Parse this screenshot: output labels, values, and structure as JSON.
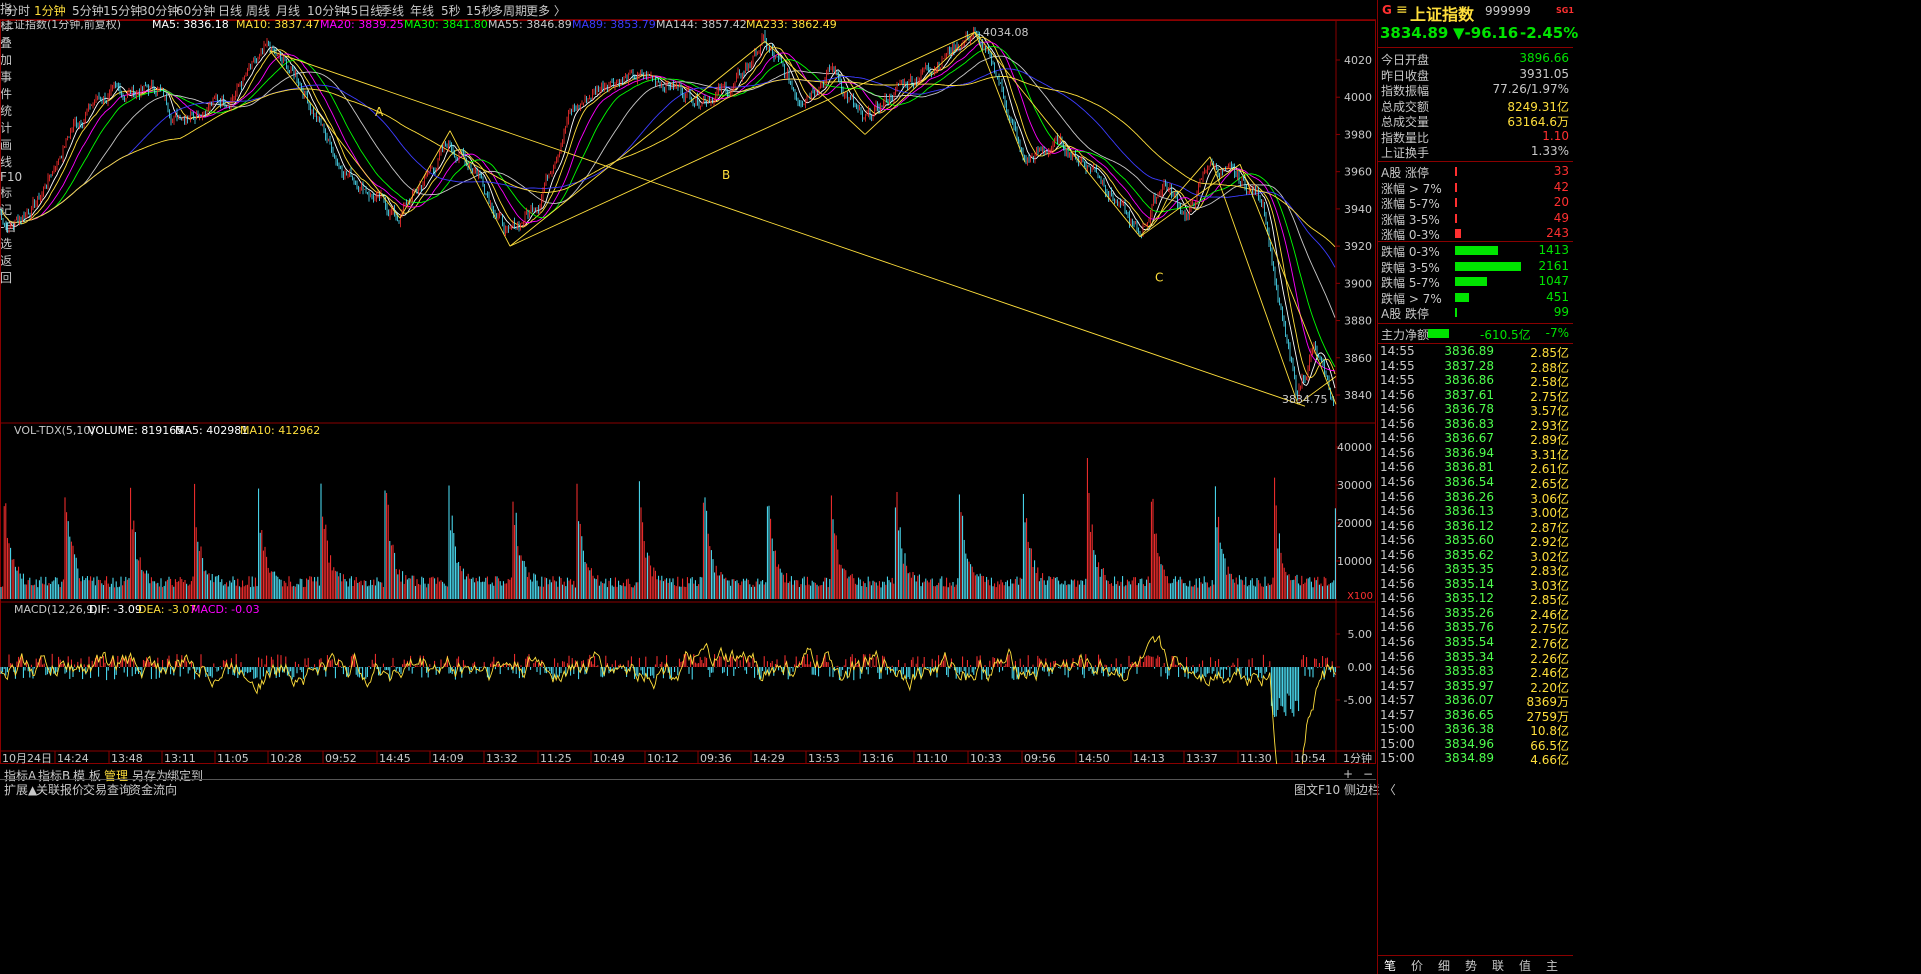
{
  "colors": {
    "up": "#ff3030",
    "down": "#00e400",
    "text": "#c8c8c8",
    "yellow": "#ffdf3c",
    "cyan": "#4fe8ff",
    "grid": "#8a0000",
    "ma5": "#ffffff",
    "ma10": "#ffdf3c",
    "ma20": "#ff00ff",
    "ma30": "#00ff00",
    "ma55": "#c8c8c8",
    "ma89": "#3c3cff"
  },
  "toolbar": {
    "periods": [
      "分时",
      "1分钟",
      "5分钟",
      "15分钟",
      "30分钟",
      "60分钟",
      "日线",
      "周线",
      "月线",
      "10分钟",
      "45日线",
      "季线",
      "年线",
      "5秒",
      "15秒",
      "多周期",
      "更多 〉"
    ],
    "active": "1分钟",
    "tools": [
      "指标",
      "叠加",
      "事件",
      "统计",
      "画线",
      "F10",
      "标记",
      "-自选",
      "返回"
    ]
  },
  "main": {
    "title": "上证指数(1分钟,前复权)",
    "ma": [
      {
        "label": "MA5: 3836.18",
        "color": "#ffffff"
      },
      {
        "label": "MA10: 3837.47",
        "color": "#ffdf3c"
      },
      {
        "label": "MA20: 3839.25",
        "color": "#ff00ff"
      },
      {
        "label": "MA30: 3841.80",
        "color": "#00ff00"
      },
      {
        "label": "MA55: 3846.89",
        "color": "#c8c8c8"
      },
      {
        "label": "MA89: 3853.79",
        "color": "#3c3cff"
      },
      {
        "label": "MA144: 3857.42",
        "color": "#c8c8c8"
      },
      {
        "label": "MA233: 3862.49",
        "color": "#ffdf3c"
      }
    ],
    "y_ticks": [
      "4020",
      "4000",
      "3980",
      "3960",
      "3940",
      "3920",
      "3900",
      "3880",
      "3860",
      "3840"
    ],
    "high_label": "4034.08",
    "low_label": "3834.75",
    "wave_labels": [
      "A",
      "B",
      "C"
    ]
  },
  "volume": {
    "label": "VOL-TDX(5,10)",
    "volume": "VOLUME: 819165",
    "ma5": "MA5: 402981",
    "ma10": "MA10: 412962",
    "y_ticks": [
      "40000",
      "30000",
      "20000",
      "10000"
    ],
    "unit": "X100"
  },
  "macd": {
    "label": "MACD(12,26,9)",
    "dif": "DIF: -3.09",
    "dea": "DEA: -3.07",
    "macd": "MACD: -0.03",
    "y_ticks": [
      "5.00",
      "0.00",
      "-5.00"
    ]
  },
  "time_axis": {
    "labels": [
      "10月24日",
      "14:24",
      "13:48",
      "13:11",
      "11:05",
      "10:28",
      "09:52",
      "14:45",
      "14:09",
      "13:32",
      "11:25",
      "10:49",
      "10:12",
      "09:36",
      "14:29",
      "13:53",
      "13:16",
      "11:10",
      "10:33",
      "09:56",
      "14:50",
      "14:13",
      "13:37",
      "11:30",
      "10:54"
    ],
    "period": "1分钟"
  },
  "bottom_tabs": {
    "row1": [
      "指标A",
      "指标B",
      "模 板",
      "管理",
      "另存为",
      "绑定到"
    ],
    "row2": [
      "扩展▲",
      "关联报价",
      "交易查询",
      "资金流向"
    ],
    "plus_minus": [
      "+",
      "−"
    ],
    "right_label": "图文F10 侧边栏 〈"
  },
  "panel": {
    "flag": "G",
    "menu_icon": "≡",
    "name": "上证指数",
    "code": "999999",
    "sg": "SG1",
    "price": "3834.89",
    "change": "▼-96.16",
    "pct": "-2.45%",
    "stats": [
      {
        "label": "今日开盘",
        "value": "3896.66",
        "color": "#00e400"
      },
      {
        "label": "昨日收盘",
        "value": "3931.05",
        "color": "#c8c8c8"
      },
      {
        "label": "指数振幅",
        "value": "77.26/1.97%",
        "color": "#c8c8c8"
      },
      {
        "label": "总成交额",
        "value": "8249.31亿",
        "color": "#ffdf3c"
      },
      {
        "label": "总成交量",
        "value": "63164.6万",
        "color": "#ffdf3c"
      },
      {
        "label": "指数量比",
        "value": "1.10",
        "color": "#ff3030"
      },
      {
        "label": "上证换手",
        "value": "1.33%",
        "color": "#c8c8c8"
      }
    ],
    "breadth_up": [
      {
        "label": "A股 涨停",
        "value": "33",
        "bar": 0.01
      },
      {
        "label": "涨幅 > 7%",
        "value": "42",
        "bar": 0.01
      },
      {
        "label": "涨幅 5-7%",
        "value": "20",
        "bar": 0.01
      },
      {
        "label": "涨幅 3-5%",
        "value": "49",
        "bar": 0.01
      },
      {
        "label": "涨幅 0-3%",
        "value": "243",
        "bar": 0.09
      }
    ],
    "breadth_down": [
      {
        "label": "跌幅 0-3%",
        "value": "1413",
        "bar": 0.65
      },
      {
        "label": "跌幅 3-5%",
        "value": "2161",
        "bar": 1.0
      },
      {
        "label": "跌幅 5-7%",
        "value": "1047",
        "bar": 0.48
      },
      {
        "label": "跌幅 > 7%",
        "value": "451",
        "bar": 0.21
      },
      {
        "label": "A股 跌停",
        "value": "99",
        "bar": 0.02
      }
    ],
    "flow": {
      "label": "主力净额",
      "value": "-610.5亿",
      "pct": "-7%",
      "bar": 0.32
    },
    "ticks": [
      [
        "14:55",
        "3836.89",
        "2.85亿"
      ],
      [
        "14:55",
        "3837.28",
        "2.88亿"
      ],
      [
        "14:55",
        "3836.86",
        "2.58亿"
      ],
      [
        "14:56",
        "3837.61",
        "2.75亿"
      ],
      [
        "14:56",
        "3836.78",
        "3.57亿"
      ],
      [
        "14:56",
        "3836.83",
        "2.93亿"
      ],
      [
        "14:56",
        "3836.67",
        "2.89亿"
      ],
      [
        "14:56",
        "3836.94",
        "3.31亿"
      ],
      [
        "14:56",
        "3836.81",
        "2.61亿"
      ],
      [
        "14:56",
        "3836.54",
        "2.65亿"
      ],
      [
        "14:56",
        "3836.26",
        "3.06亿"
      ],
      [
        "14:56",
        "3836.13",
        "3.00亿"
      ],
      [
        "14:56",
        "3836.12",
        "2.87亿"
      ],
      [
        "14:56",
        "3835.60",
        "2.92亿"
      ],
      [
        "14:56",
        "3835.62",
        "3.02亿"
      ],
      [
        "14:56",
        "3835.35",
        "2.83亿"
      ],
      [
        "14:56",
        "3835.14",
        "3.03亿"
      ],
      [
        "14:56",
        "3835.12",
        "2.85亿"
      ],
      [
        "14:56",
        "3835.26",
        "2.46亿"
      ],
      [
        "14:56",
        "3835.76",
        "2.75亿"
      ],
      [
        "14:56",
        "3835.54",
        "2.76亿"
      ],
      [
        "14:56",
        "3835.34",
        "2.26亿"
      ],
      [
        "14:56",
        "3835.83",
        "2.46亿"
      ],
      [
        "14:57",
        "3835.97",
        "2.20亿"
      ],
      [
        "14:57",
        "3836.07",
        "8369万"
      ],
      [
        "14:57",
        "3836.65",
        "2759万"
      ],
      [
        "15:00",
        "3836.38",
        "10.8亿"
      ],
      [
        "15:00",
        "3834.96",
        "66.5亿"
      ],
      [
        "15:00",
        "3834.89",
        "4.66亿"
      ]
    ],
    "bottom_tabs": [
      "笔",
      "价",
      "细",
      "势",
      "联",
      "值",
      "主"
    ]
  }
}
